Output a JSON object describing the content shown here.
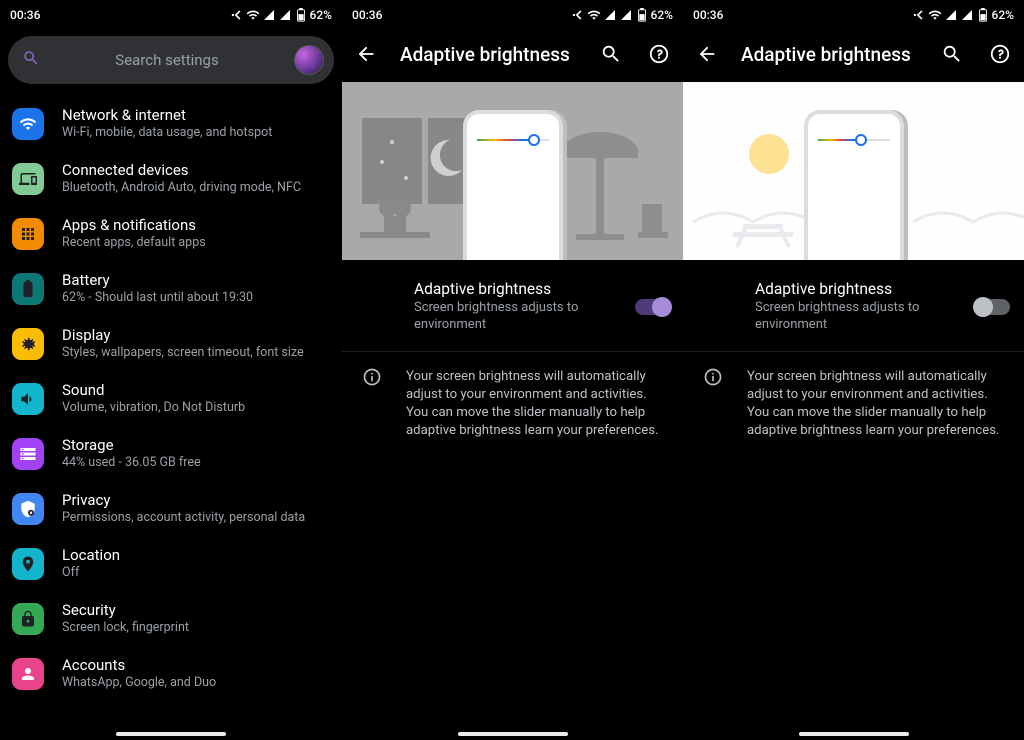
{
  "status": {
    "time": "00:36",
    "battery": "62%"
  },
  "search": {
    "placeholder": "Search settings"
  },
  "settings_items": [
    {
      "title": "Network & internet",
      "sub": "Wi-Fi, mobile, data usage, and hotspot",
      "icon": "wifi",
      "bg": "#1a73e8"
    },
    {
      "title": "Connected devices",
      "sub": "Bluetooth, Android Auto, driving mode, NFC",
      "icon": "devices",
      "bg": "#81c995"
    },
    {
      "title": "Apps & notifications",
      "sub": "Recent apps, default apps",
      "icon": "apps",
      "bg": "#f28b00"
    },
    {
      "title": "Battery",
      "sub": "62% - Should last until about 19:30",
      "icon": "battery",
      "bg": "#0d7775"
    },
    {
      "title": "Display",
      "sub": "Styles, wallpapers, screen timeout, font size",
      "icon": "display",
      "bg": "#fbbc04"
    },
    {
      "title": "Sound",
      "sub": "Volume, vibration, Do Not Disturb",
      "icon": "sound",
      "bg": "#12b5cb"
    },
    {
      "title": "Storage",
      "sub": "44% used - 36.05 GB free",
      "icon": "storage",
      "bg": "#a142f4"
    },
    {
      "title": "Privacy",
      "sub": "Permissions, account activity, personal data",
      "icon": "privacy",
      "bg": "#4285f4"
    },
    {
      "title": "Location",
      "sub": "Off",
      "icon": "location",
      "bg": "#12b5cb"
    },
    {
      "title": "Security",
      "sub": "Screen lock, fingerprint",
      "icon": "security",
      "bg": "#34a853"
    },
    {
      "title": "Accounts",
      "sub": "WhatsApp, Google, and Duo",
      "icon": "accounts",
      "bg": "#e8438b"
    }
  ],
  "detail": {
    "page_title": "Adaptive brightness",
    "setting_title": "Adaptive brightness",
    "setting_sub": "Screen brightness adjusts to environment",
    "info_text": "Your screen brightness will automatically adjust to your environment and activities. You can move the slider manually to help adaptive brightness learn your preferences.",
    "states": [
      {
        "enabled": true
      },
      {
        "enabled": false
      }
    ]
  }
}
